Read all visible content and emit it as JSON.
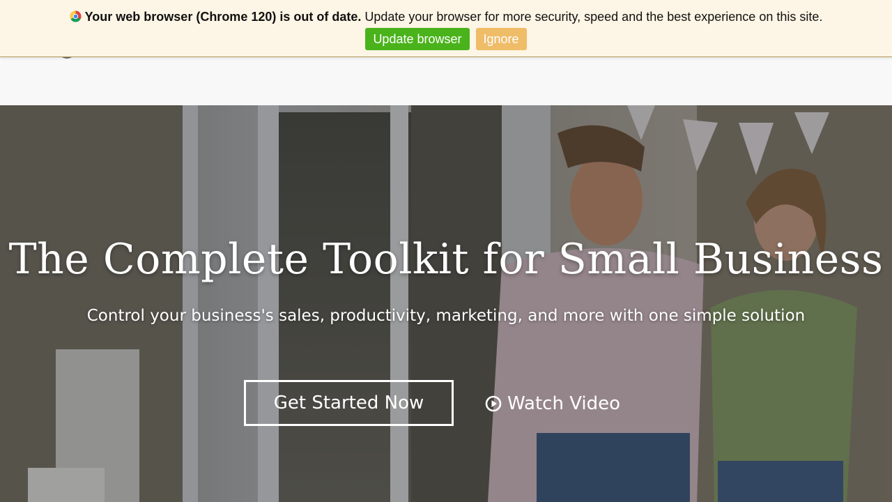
{
  "banner": {
    "bold_text": "Your web browser (Chrome 120) is out of date.",
    "text": " Update your browser for more security, speed and the best experience on this site.",
    "update_label": "Update browser",
    "ignore_label": "Ignore"
  },
  "hero": {
    "title": "The Complete Toolkit for Small Business",
    "subtitle": "Control your business's sales, productivity, marketing, and more with one simple solution",
    "cta_primary": "Get Started Now",
    "cta_video": "Watch Video"
  },
  "icons": {
    "browser": "chrome-icon",
    "video": "play-circle-icon"
  },
  "colors": {
    "banner_bg": "#fdf5e5",
    "update_button": "#4ab31b",
    "ignore_button": "#efbc68",
    "hero_text": "#ffffff"
  }
}
